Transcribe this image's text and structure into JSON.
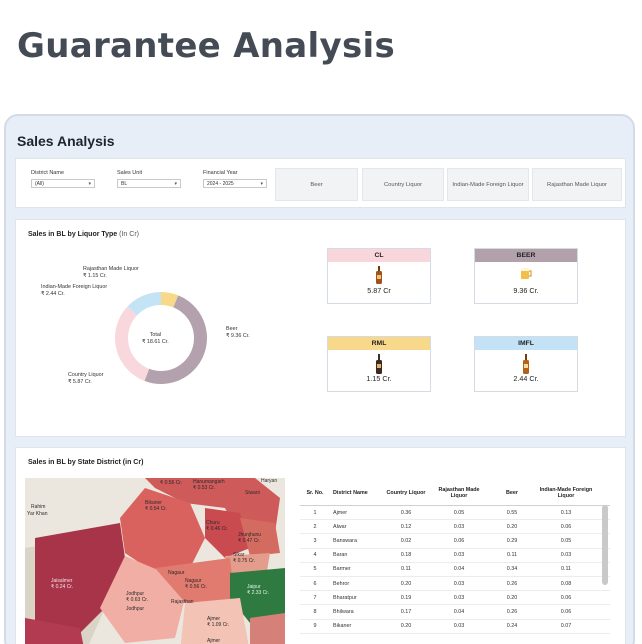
{
  "page_title": "Guarantee Analysis",
  "dashboard": {
    "title": "Sales Analysis",
    "filters": [
      {
        "label": "District Name",
        "value": "(All)"
      },
      {
        "label": "Sales Unit",
        "value": "BL"
      },
      {
        "label": "Financial Year",
        "value": "2024 - 2025"
      }
    ],
    "type_buttons": [
      "Beer",
      "Country Liquor",
      "Indian-Made Foreign Liquor",
      "Rajasthan Made Liquor"
    ]
  },
  "liquor_panel": {
    "title": "Sales in BL by Liquor Type",
    "title_unit": "(In Cr)",
    "donut": {
      "center_label": "Total",
      "center_value": "₹ 18.61 Cr.",
      "segments": [
        {
          "name": "Beer",
          "value": 9.36,
          "label": "₹ 9.36 Cr.",
          "color": "#b3a2ad"
        },
        {
          "name": "Country Liquor",
          "value": 5.87,
          "label": "₹ 5.87 Cr.",
          "color": "#f8d8dc"
        },
        {
          "name": "Indian-Made Foreign Liquor",
          "value": 2.44,
          "label": "₹ 2.44 Cr.",
          "color": "#c4e3f5"
        },
        {
          "name": "Rajasthan Made Liquor",
          "value": 1.15,
          "label": "₹ 1.15 Cr.",
          "color": "#f8d98a"
        }
      ]
    },
    "cards": [
      {
        "name": "CL",
        "value": "5.87 Cr",
        "color": "#f8d6db",
        "icon": "bottle-icon"
      },
      {
        "name": "BEER",
        "value": "9.36 Cr.",
        "color": "#b2a1ab",
        "icon": "beer-mug-icon"
      },
      {
        "name": "RML",
        "value": "1.15 Cr.",
        "color": "#f8d98c",
        "icon": "bottle-icon"
      },
      {
        "name": "IMFL",
        "value": "2.44 Cr.",
        "color": "#c3e2f5",
        "icon": "bottle-icon"
      }
    ]
  },
  "district_panel": {
    "title": "Sales in BL by State District (in Cr)",
    "map_labels": [
      {
        "text": "Hanumangarh",
        "sub": "₹ 0.53 Cr."
      },
      {
        "text": "",
        "sub": "₹ 0.56 Cr."
      },
      {
        "text": "Haryan",
        "sub": ""
      },
      {
        "text": "Siwani",
        "sub": ""
      },
      {
        "text": "Rahim",
        "sub": ""
      },
      {
        "text": "Yar Khan",
        "sub": ""
      },
      {
        "text": "Bikaner",
        "sub": "₹ 0.54 Cr."
      },
      {
        "text": "Churu",
        "sub": "₹ 0.46 Cr."
      },
      {
        "text": "Jhunjhunu",
        "sub": "₹ 0.47 Cr."
      },
      {
        "text": "Sikar",
        "sub": "₹ 0.75 Cr."
      },
      {
        "text": "Nagaur",
        "sub": ""
      },
      {
        "text": "Nagaur",
        "sub": "₹ 0.56 Cr."
      },
      {
        "text": "Jaisalmer",
        "sub": "₹ 0.24 Cr."
      },
      {
        "text": "Jodhpur",
        "sub": "₹ 0.63 Cr."
      },
      {
        "text": "Jodhpur",
        "sub": ""
      },
      {
        "text": "Rajasthan",
        "sub": ""
      },
      {
        "text": "Jaipur",
        "sub": "₹ 2.33 Cr."
      },
      {
        "text": "Ajmer",
        "sub": "₹ 1.09 Cr."
      },
      {
        "text": "Ajmer",
        "sub": ""
      }
    ],
    "table": {
      "headers": [
        "Sr. No.",
        "District Name",
        "Country Liquor",
        "Rajasthan Made Liquor",
        "Beer",
        "Indian-Made Foreign Liquor"
      ],
      "rows": [
        [
          "1",
          "Ajmer",
          "0.36",
          "0.05",
          "0.55",
          "0.13"
        ],
        [
          "2",
          "Alwar",
          "0.12",
          "0.03",
          "0.20",
          "0.06"
        ],
        [
          "3",
          "Banswara",
          "0.02",
          "0.06",
          "0.29",
          "0.05"
        ],
        [
          "4",
          "Baran",
          "0.18",
          "0.03",
          "0.11",
          "0.03"
        ],
        [
          "5",
          "Barmer",
          "0.11",
          "0.04",
          "0.34",
          "0.11"
        ],
        [
          "6",
          "Behror",
          "0.20",
          "0.03",
          "0.26",
          "0.08"
        ],
        [
          "7",
          "Bharatpur",
          "0.19",
          "0.03",
          "0.20",
          "0.06"
        ],
        [
          "8",
          "Bhilwara",
          "0.17",
          "0.04",
          "0.26",
          "0.06"
        ],
        [
          "9",
          "Bikaner",
          "0.20",
          "0.03",
          "0.24",
          "0.07"
        ]
      ]
    }
  }
}
